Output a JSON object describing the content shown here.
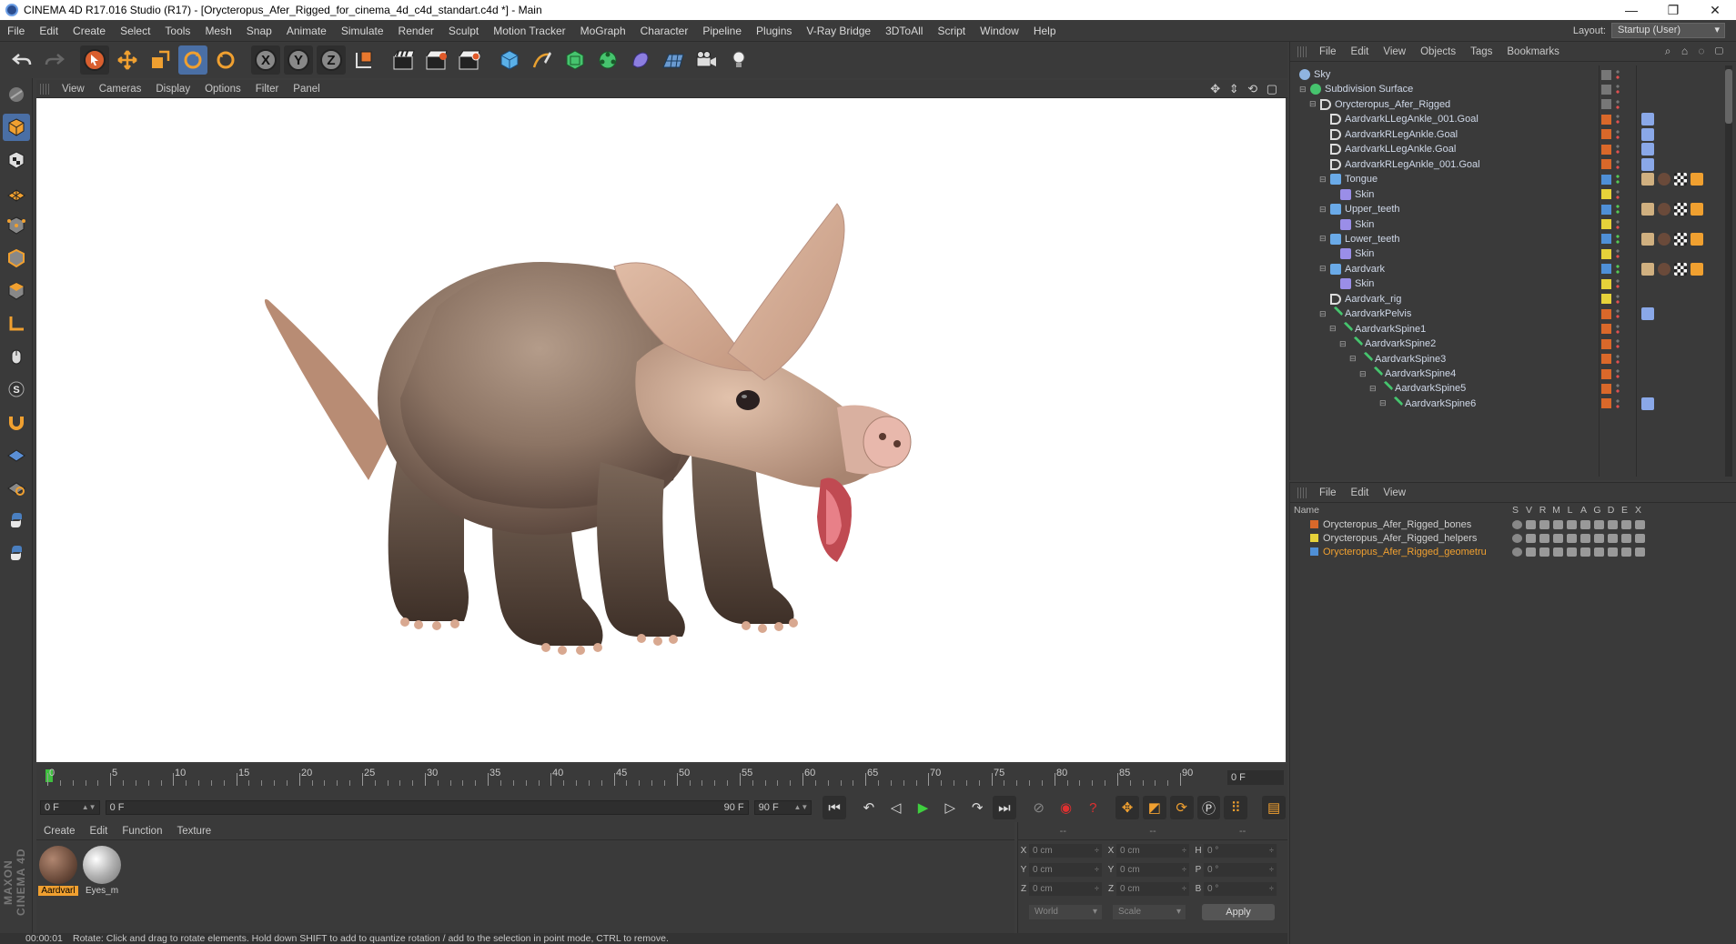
{
  "window": {
    "title": "CINEMA 4D R17.016 Studio (R17) - [Orycteropus_Afer_Rigged_for_cinema_4d_c4d_standart.c4d *] - Main"
  },
  "menubar": {
    "items": [
      "File",
      "Edit",
      "Create",
      "Select",
      "Tools",
      "Mesh",
      "Snap",
      "Animate",
      "Simulate",
      "Render",
      "Sculpt",
      "Motion Tracker",
      "MoGraph",
      "Character",
      "Pipeline",
      "Plugins",
      "V-Ray Bridge",
      "3DToAll",
      "Script",
      "Window",
      "Help"
    ],
    "layout_label": "Layout:",
    "layout_value": "Startup (User)"
  },
  "toolbar": {
    "axis": [
      "X",
      "Y",
      "Z"
    ]
  },
  "viewport": {
    "menu": [
      "View",
      "Cameras",
      "Display",
      "Options",
      "Filter",
      "Panel"
    ]
  },
  "timeline": {
    "ticks": [
      0,
      5,
      10,
      15,
      20,
      25,
      30,
      35,
      40,
      45,
      50,
      55,
      60,
      65,
      70,
      75,
      80,
      85,
      90
    ],
    "current_frame": "0 F"
  },
  "transport": {
    "start": "0 F",
    "range_left": "0 F",
    "range_right": "90 F",
    "end": "90 F"
  },
  "materials": {
    "menu": [
      "Create",
      "Edit",
      "Function",
      "Texture"
    ],
    "items": [
      {
        "name": "Aardvarl",
        "selected": true
      },
      {
        "name": "Eyes_m",
        "selected": false
      }
    ]
  },
  "coordinates": {
    "headers": [
      "--",
      "--",
      "--"
    ],
    "rows": [
      {
        "a1": "X",
        "v1": "0 cm",
        "a2": "X",
        "v2": "0 cm",
        "a3": "H",
        "v3": "0 °"
      },
      {
        "a1": "Y",
        "v1": "0 cm",
        "a2": "Y",
        "v2": "0 cm",
        "a3": "P",
        "v3": "0 °"
      },
      {
        "a1": "Z",
        "v1": "0 cm",
        "a2": "Z",
        "v2": "0 cm",
        "a3": "B",
        "v3": "0 °"
      }
    ],
    "mode1": "World",
    "mode2": "Scale",
    "apply": "Apply"
  },
  "status": {
    "time": "00:00:01",
    "message": "Rotate: Click and drag to rotate elements. Hold down SHIFT to add to quantize rotation / add to the selection in point mode, CTRL to remove."
  },
  "object_manager": {
    "menu": [
      "File",
      "Edit",
      "View",
      "Objects",
      "Tags",
      "Bookmarks"
    ],
    "objects": [
      {
        "name": "Sky",
        "depth": 0,
        "icon": "sky",
        "tag": "#777777",
        "tags": []
      },
      {
        "name": "Subdivision Surface",
        "depth": 0,
        "icon": "subd",
        "tag": "#777777",
        "tags": []
      },
      {
        "name": "Orycteropus_Afer_Rigged",
        "depth": 1,
        "icon": "null",
        "tag": "#777777",
        "tags": []
      },
      {
        "name": "AardvarkLLegAnkle_001.Goal",
        "depth": 2,
        "icon": "null",
        "tag": "#d9682a",
        "tags": [
          "ik"
        ]
      },
      {
        "name": "AardvarkRLegAnkle.Goal",
        "depth": 2,
        "icon": "null",
        "tag": "#d9682a",
        "tags": [
          "ik"
        ]
      },
      {
        "name": "AardvarkLLegAnkle.Goal",
        "depth": 2,
        "icon": "null",
        "tag": "#d9682a",
        "tags": [
          "ik"
        ]
      },
      {
        "name": "AardvarkRLegAnkle_001.Goal",
        "depth": 2,
        "icon": "null",
        "tag": "#d9682a",
        "tags": [
          "ik"
        ]
      },
      {
        "name": "Tongue",
        "depth": 2,
        "icon": "mesh",
        "tag": "#4f8fd6",
        "tags": [
          "uv",
          "mat",
          "chk",
          "wgt"
        ]
      },
      {
        "name": "Skin",
        "depth": 3,
        "icon": "skin",
        "tag": "#e6d23a",
        "tags": []
      },
      {
        "name": "Upper_teeth",
        "depth": 2,
        "icon": "mesh",
        "tag": "#4f8fd6",
        "tags": [
          "uv",
          "mat",
          "chk",
          "wgt"
        ]
      },
      {
        "name": "Skin",
        "depth": 3,
        "icon": "skin",
        "tag": "#e6d23a",
        "tags": []
      },
      {
        "name": "Lower_teeth",
        "depth": 2,
        "icon": "mesh",
        "tag": "#4f8fd6",
        "tags": [
          "uv",
          "mat",
          "chk",
          "wgt"
        ]
      },
      {
        "name": "Skin",
        "depth": 3,
        "icon": "skin",
        "tag": "#e6d23a",
        "tags": []
      },
      {
        "name": "Aardvark",
        "depth": 2,
        "icon": "mesh",
        "tag": "#4f8fd6",
        "tags": [
          "uv",
          "mat",
          "chk",
          "wgt"
        ]
      },
      {
        "name": "Skin",
        "depth": 3,
        "icon": "skin",
        "tag": "#e6d23a",
        "tags": []
      },
      {
        "name": "Aardvark_rig",
        "depth": 2,
        "icon": "null",
        "tag": "#e6d23a",
        "tags": []
      },
      {
        "name": "AardvarkPelvis",
        "depth": 2,
        "icon": "bone",
        "tag": "#d9682a",
        "tags": [
          "ik"
        ]
      },
      {
        "name": "AardvarkSpine1",
        "depth": 3,
        "icon": "bone",
        "tag": "#d9682a",
        "tags": []
      },
      {
        "name": "AardvarkSpine2",
        "depth": 4,
        "icon": "bone",
        "tag": "#d9682a",
        "tags": []
      },
      {
        "name": "AardvarkSpine3",
        "depth": 5,
        "icon": "bone",
        "tag": "#d9682a",
        "tags": []
      },
      {
        "name": "AardvarkSpine4",
        "depth": 6,
        "icon": "bone",
        "tag": "#d9682a",
        "tags": []
      },
      {
        "name": "AardvarkSpine5",
        "depth": 7,
        "icon": "bone",
        "tag": "#d9682a",
        "tags": []
      },
      {
        "name": "AardvarkSpine6",
        "depth": 8,
        "icon": "bone",
        "tag": "#d9682a",
        "tags": [
          "ik"
        ]
      }
    ]
  },
  "layer_manager": {
    "menu": [
      "File",
      "Edit",
      "View"
    ],
    "columns": [
      "Name",
      "S",
      "V",
      "R",
      "M",
      "L",
      "A",
      "G",
      "D",
      "E",
      "X"
    ],
    "layers": [
      {
        "name": "Orycteropus_Afer_Rigged_bones",
        "color": "#d9682a",
        "text_color": "#d0d0d0"
      },
      {
        "name": "Orycteropus_Afer_Rigged_helpers",
        "color": "#e6d23a",
        "text_color": "#d0d0d0"
      },
      {
        "name": "Orycteropus_Afer_Rigged_geometru",
        "color": "#4f8fd6",
        "text_color": "#f0a030"
      }
    ]
  }
}
